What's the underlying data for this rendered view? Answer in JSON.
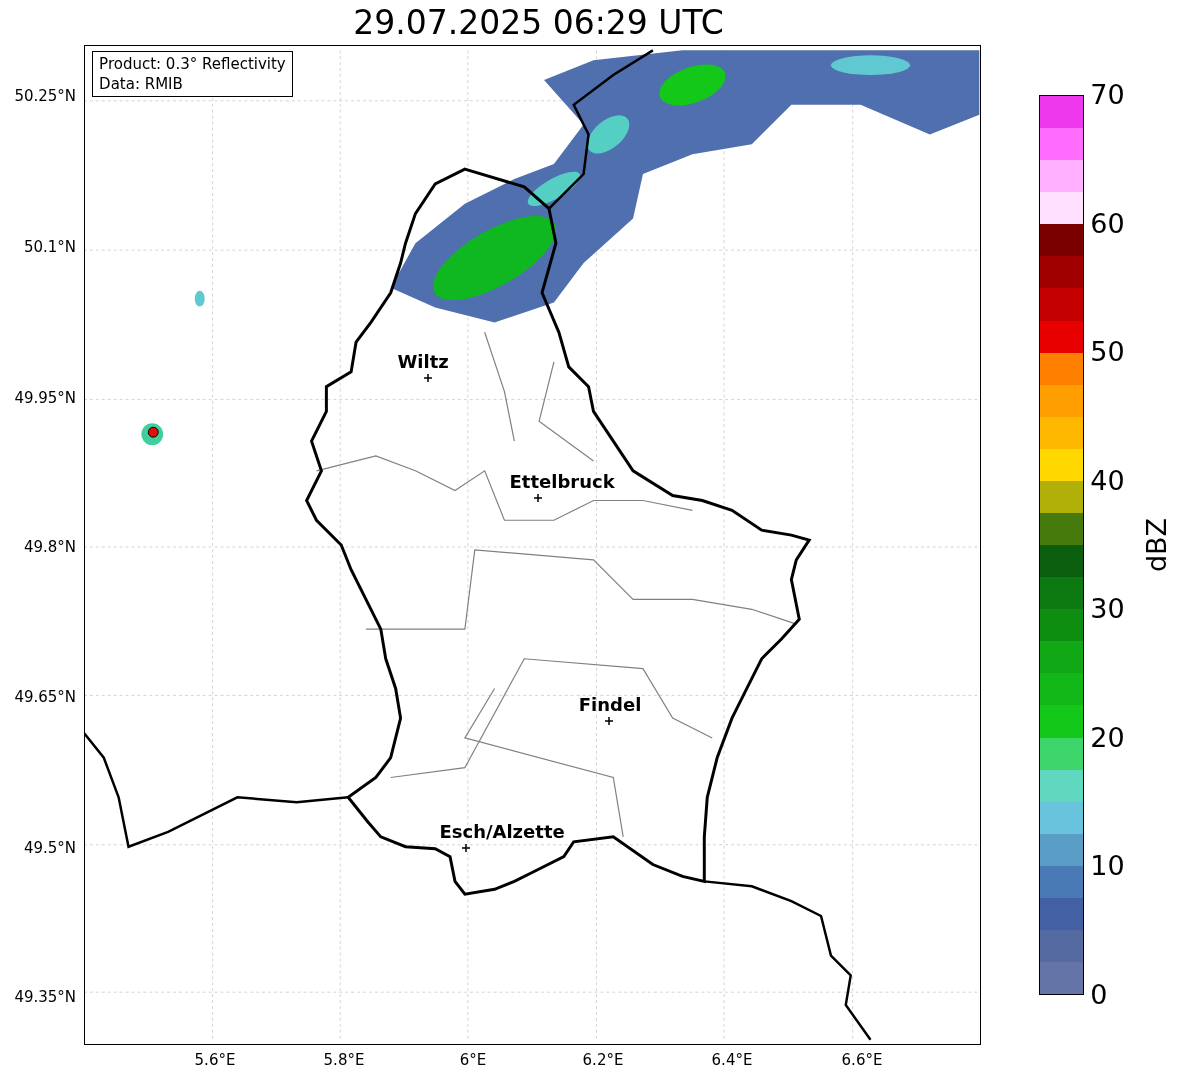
{
  "title": "29.07.2025 06:29 UTC",
  "info_box": {
    "lines": [
      "Product: 0.3° Reflectivity",
      "Data: RMIB"
    ]
  },
  "map": {
    "cities": [
      {
        "name": "Wiltz"
      },
      {
        "name": "Ettelbruck"
      },
      {
        "name": "Findel"
      },
      {
        "name": "Esch/Alzette"
      }
    ]
  },
  "lat_labels": [
    "50.25°N",
    "50.1°N",
    "49.95°N",
    "49.8°N",
    "49.65°N",
    "49.5°N",
    "49.35°N"
  ],
  "lon_labels": [
    "5.6°E",
    "5.8°E",
    "6°E",
    "6.2°E",
    "6.4°E",
    "6.6°E"
  ],
  "colorbar": {
    "label": "dBZ",
    "ticks": [
      "70",
      "60",
      "50",
      "40",
      "30",
      "20",
      "10",
      "0"
    ],
    "levels": [
      {
        "color": "#ee38ee"
      },
      {
        "color": "#ff6cff"
      },
      {
        "color": "#ffb0ff"
      },
      {
        "color": "#ffe0ff"
      },
      {
        "color": "#7a0000"
      },
      {
        "color": "#a00000"
      },
      {
        "color": "#c40000"
      },
      {
        "color": "#e80000"
      },
      {
        "color": "#ff8000"
      },
      {
        "color": "#ff9e00"
      },
      {
        "color": "#ffb800"
      },
      {
        "color": "#ffd800"
      },
      {
        "color": "#b0b008"
      },
      {
        "color": "#467a0c"
      },
      {
        "color": "#0a5e0e"
      },
      {
        "color": "#0c7a10"
      },
      {
        "color": "#0e8e10"
      },
      {
        "color": "#10a814"
      },
      {
        "color": "#12b818"
      },
      {
        "color": "#14c81a"
      },
      {
        "color": "#3ed66a"
      },
      {
        "color": "#60d8c0"
      },
      {
        "color": "#68c3dc"
      },
      {
        "color": "#5a9ec8"
      },
      {
        "color": "#4a7ab5"
      },
      {
        "color": "#4460a5"
      },
      {
        "color": "#556aa0"
      },
      {
        "color": "#6474a6"
      }
    ]
  }
}
